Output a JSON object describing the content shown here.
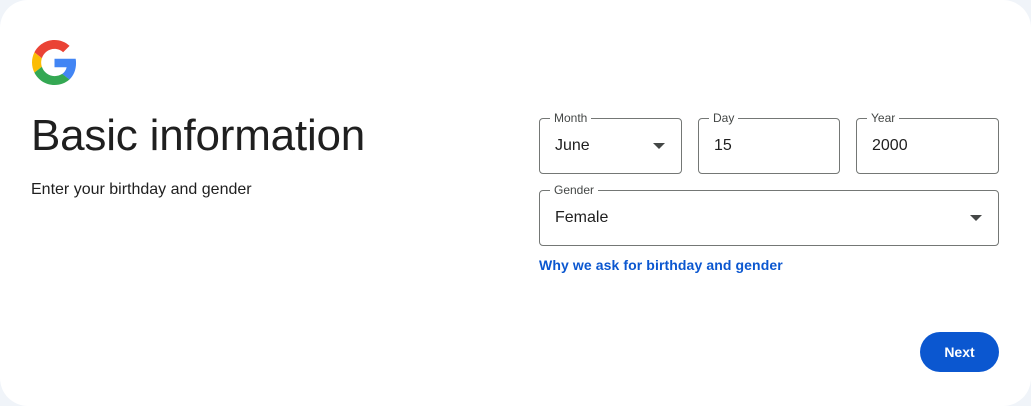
{
  "header": {
    "logo_icon": "google-g-icon",
    "title": "Basic information",
    "subtitle": "Enter your birthday and gender"
  },
  "form": {
    "month": {
      "label": "Month",
      "value": "June",
      "icon": "chevron-down-icon"
    },
    "day": {
      "label": "Day",
      "value": "15"
    },
    "year": {
      "label": "Year",
      "value": "2000"
    },
    "gender": {
      "label": "Gender",
      "value": "Female",
      "icon": "chevron-down-icon"
    }
  },
  "links": {
    "why_ask": "Why we ask for birthday and gender"
  },
  "actions": {
    "next_label": "Next"
  },
  "colors": {
    "primary": "#0b57d0",
    "border": "#747775",
    "text": "#1f1f1f",
    "background": "#f0f4f9"
  }
}
